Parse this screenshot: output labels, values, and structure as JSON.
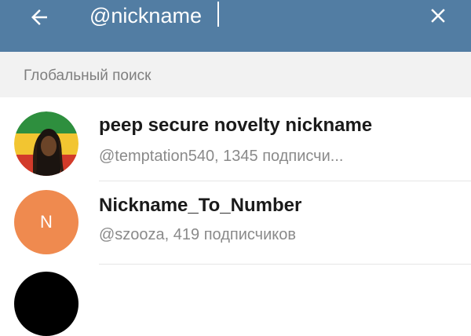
{
  "search": {
    "value": "@nickname"
  },
  "section": {
    "title": "Глобальный поиск"
  },
  "results": [
    {
      "name": "peep secure novelty nickname",
      "subtitle": "@temptation540, 1345 подписчи...",
      "avatar": "rasta-portrait-image"
    },
    {
      "name": "Nickname_To_Number",
      "subtitle": "@szooza, 419 подписчиков",
      "avatar_letter": "N",
      "avatar_color": "#ef8a4f"
    },
    {
      "avatar_color": "#000000"
    }
  ],
  "colors": {
    "header": "#527da3",
    "section_bg": "#f2f2f2"
  },
  "icons": {
    "back": "arrow-left-icon",
    "clear": "close-icon"
  }
}
